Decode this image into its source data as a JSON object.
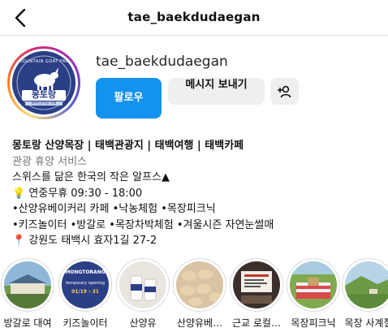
{
  "header": {
    "title": "tae_baekdudaegan",
    "back_icon": "chevron-left-icon"
  },
  "profile": {
    "username": "tae_baekdudaegan",
    "avatar_text_top": "MOUNTAIN GOAT FARM",
    "avatar_text_main": "몽토랑",
    "avatar_text_sub": "태백산양목장 카페",
    "follow_label": "팔로우",
    "message_label": "메시지 보내기",
    "add_user_icon": "add-person-icon"
  },
  "bio": {
    "name": "몽토랑 산양목장 | 태백관광지 | 태백여행 | 태백카페",
    "category": "관광 휴양 서비스",
    "line1": "스위스를 닮은 한국의 작은 알프스▲",
    "line2": "💡 연중무휴 09:30 - 18:00",
    "line3": "•산양유베이커리 카페 •낙농체험 •목장피크닉",
    "line4": "•키즈놀이터 •방갈로 •목장차박체험 •겨울시즌 자연눈썰매",
    "line5": "📍 강원도 태백시 효자1길 27-2"
  },
  "highlights": [
    {
      "label": "방갈로 대여"
    },
    {
      "label": "키즈놀이터",
      "overlay": "MONGTORANG",
      "overlay2": "temporary opening",
      "overlay3": "01/19 - 31"
    },
    {
      "label": "산양유"
    },
    {
      "label": "산양유베…"
    },
    {
      "label": "근교 로컬…"
    },
    {
      "label": "목장피크닉"
    },
    {
      "label": "목장 사계절"
    }
  ],
  "colors": {
    "follow_blue": "#1492ef",
    "button_grey": "#efefef",
    "avatar_navy": "#2b3f87"
  }
}
